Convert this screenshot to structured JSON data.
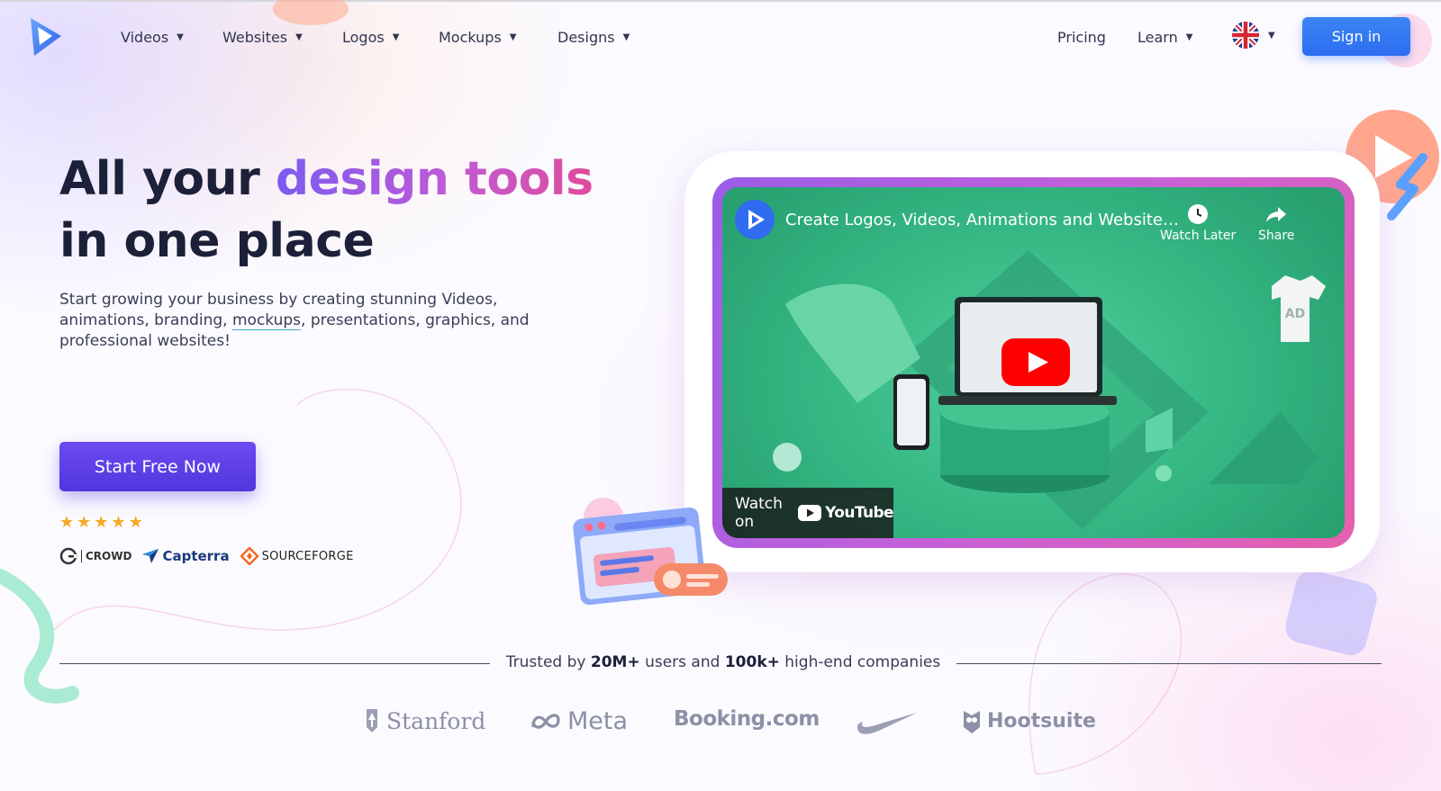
{
  "nav": {
    "items": [
      {
        "label": "Videos"
      },
      {
        "label": "Websites"
      },
      {
        "label": "Logos"
      },
      {
        "label": "Mockups"
      },
      {
        "label": "Designs"
      }
    ],
    "pricing": "Pricing",
    "learn": "Learn",
    "sign_in": "Sign in",
    "language_icon": "uk-flag-icon"
  },
  "hero": {
    "headline_part1": "All your ",
    "headline_highlight": "design tools",
    "headline_part2": "in one place",
    "sub_before": "Start growing your business by creating stunning Videos, animations, branding, ",
    "sub_link": "mockups",
    "sub_after": ", presentations, graphics, and professional websites!",
    "cta": "Start Free Now",
    "rating_stars": 5,
    "review_sites": [
      "CROWD",
      "Capterra",
      "SOURCEFORGE"
    ]
  },
  "video": {
    "title": "Create Logos, Videos, Animations and Website…",
    "watch_later": "Watch Later",
    "share": "Share",
    "watch_on": "Watch on",
    "youtube": "YouTube"
  },
  "trusted": {
    "prefix": "Trusted by ",
    "users": "20M+",
    "middle": " users and ",
    "companies": "100k+",
    "suffix": " high-end companies",
    "logos": [
      "Stanford",
      "Meta",
      "Booking.com",
      "Hootsuite"
    ]
  },
  "colors": {
    "primary_blue": "#2b6ef0",
    "cta_purple": "#5a3de6",
    "text_dark": "#1c2038",
    "star": "#f6a823"
  }
}
